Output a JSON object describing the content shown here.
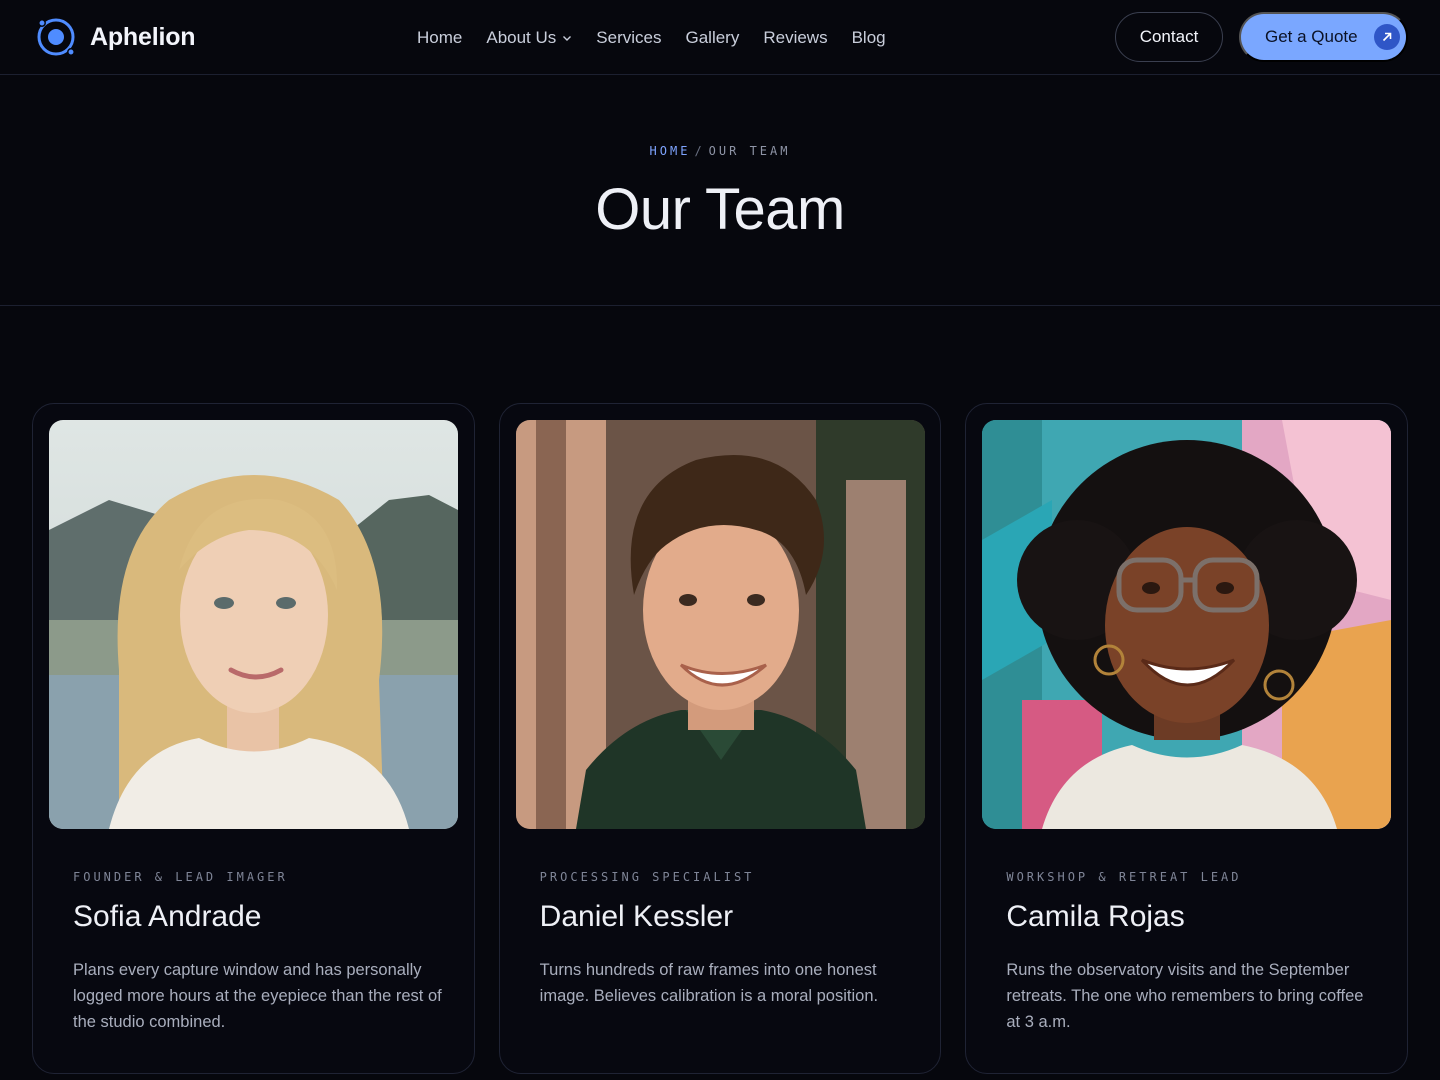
{
  "brand": {
    "name": "Aphelion",
    "logo_icon": "orbit-logo-icon",
    "accent": "#4f8cff"
  },
  "nav": {
    "items": [
      {
        "label": "Home"
      },
      {
        "label": "About Us",
        "has_dropdown": true
      },
      {
        "label": "Services"
      },
      {
        "label": "Gallery"
      },
      {
        "label": "Reviews"
      },
      {
        "label": "Blog"
      }
    ],
    "contact_label": "Contact",
    "quote_label": "Get a Quote",
    "quote_icon": "arrow-up-right-icon",
    "quote_color": "#7aa7ff"
  },
  "hero": {
    "breadcrumb_home": "HOME",
    "breadcrumb_sep": "/",
    "breadcrumb_current": "OUR TEAM",
    "title": "Our Team"
  },
  "team": [
    {
      "role": "FOUNDER & LEAD IMAGER",
      "name": "Sofia Andrade",
      "bio": "Plans every capture window and has personally logged more hours at the eyepiece than the rest of the studio combined."
    },
    {
      "role": "PROCESSING SPECIALIST",
      "name": "Daniel Kessler",
      "bio": "Turns hundreds of raw frames into one honest image. Believes calibration is a moral position."
    },
    {
      "role": "WORKSHOP & RETREAT LEAD",
      "name": "Camila Rojas",
      "bio": "Runs the observatory visits and the September retreats. The one who remembers to bring coffee at 3 a.m."
    }
  ]
}
